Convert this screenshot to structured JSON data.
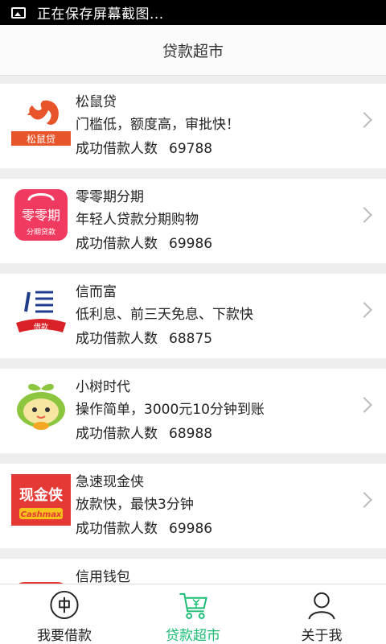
{
  "status_bar": {
    "text": "正在保存屏幕截图..."
  },
  "header": {
    "title": "贷款超市"
  },
  "loans": [
    {
      "name": "松鼠贷",
      "desc": "门槛低，额度高，审批快！",
      "count_label": "成功借款人数",
      "count": "69788",
      "logo_text": "松鼠贷",
      "logo_icon": "squirrel-logo"
    },
    {
      "name": "零零期分期",
      "desc": "年轻人贷款分期购物",
      "count_label": "成功借款人数",
      "count": "69986",
      "logo_text": "零零期",
      "logo_sub": "分期贷款",
      "logo_icon": "lingling-logo"
    },
    {
      "name": "信而富",
      "desc": "低利息、前三天免息、下款快",
      "count_label": "成功借款人数",
      "count": "68875",
      "logo_text": "借款",
      "logo_icon": "xin-logo"
    },
    {
      "name": "小树时代",
      "desc": "操作简单，3000元10分钟到账",
      "count_label": "成功借款人数",
      "count": "68988",
      "logo_icon": "sprout-logo"
    },
    {
      "name": "急速现金侠",
      "desc": "放款快，最快3分钟",
      "count_label": "成功借款人数",
      "count": "69986",
      "logo_text": "现金侠",
      "logo_sub": "Cashmax",
      "logo_icon": "cashmax-logo"
    },
    {
      "name": "信用钱包",
      "logo_icon": "wallet-logo"
    }
  ],
  "tabs": [
    {
      "label": "我要借款",
      "icon": "coin-icon",
      "active": false
    },
    {
      "label": "贷款超市",
      "icon": "cart-icon",
      "active": true
    },
    {
      "label": "关于我",
      "icon": "user-icon",
      "active": false
    }
  ],
  "colors": {
    "accent": "#1abc73",
    "orange": "#e8552a",
    "red": "#e53935"
  }
}
